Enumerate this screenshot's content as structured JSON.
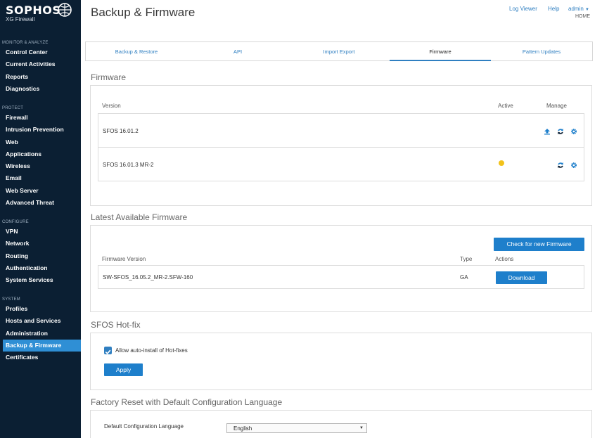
{
  "brand": {
    "name": "SOPHOS",
    "product": "XG Firewall"
  },
  "sidebar": {
    "sections": [
      {
        "heading": "MONITOR & ANALYZE",
        "items": [
          "Control Center",
          "Current Activities",
          "Reports",
          "Diagnostics"
        ]
      },
      {
        "heading": "PROTECT",
        "items": [
          "Firewall",
          "Intrusion Prevention",
          "Web",
          "Applications",
          "Wireless",
          "Email",
          "Web Server",
          "Advanced Threat"
        ]
      },
      {
        "heading": "CONFIGURE",
        "items": [
          "VPN",
          "Network",
          "Routing",
          "Authentication",
          "System Services"
        ]
      },
      {
        "heading": "SYSTEM",
        "items": [
          "Profiles",
          "Hosts and Services",
          "Administration",
          "Backup & Firmware",
          "Certificates"
        ]
      }
    ],
    "active_item": "Backup & Firmware"
  },
  "header": {
    "title": "Backup & Firmware",
    "log_viewer": "Log Viewer",
    "help": "Help",
    "user": "admin",
    "home": "HOME"
  },
  "tabs": [
    "Backup & Restore",
    "API",
    "Import Export",
    "Firmware",
    "Pattern Updates"
  ],
  "active_tab": "Firmware",
  "firmware": {
    "title": "Firmware",
    "columns": {
      "version": "Version",
      "active": "Active",
      "manage": "Manage"
    },
    "rows": [
      {
        "version": "SFOS 16.01.2",
        "active": false
      },
      {
        "version": "SFOS 16.01.3 MR-2",
        "active": true
      }
    ]
  },
  "latest": {
    "title": "Latest Available Firmware",
    "check_button": "Check for new Firmware",
    "columns": {
      "version": "Firmware Version",
      "type": "Type",
      "actions": "Actions"
    },
    "rows": [
      {
        "version": "SW-SFOS_16.05.2_MR-2.SFW-160",
        "type": "GA",
        "action": "Download"
      }
    ]
  },
  "hotfix": {
    "title": "SFOS Hot-fix",
    "checkbox_label": "Allow auto-install of Hot-fixes",
    "checked": true,
    "apply_button": "Apply"
  },
  "factory_reset": {
    "title": "Factory Reset with Default Configuration Language",
    "label": "Default Configuration Language",
    "selected": "English"
  },
  "colors": {
    "sidebar_bg": "#0b1f33",
    "accent": "#2f7fc1",
    "active_dot": "#f2c21a"
  }
}
